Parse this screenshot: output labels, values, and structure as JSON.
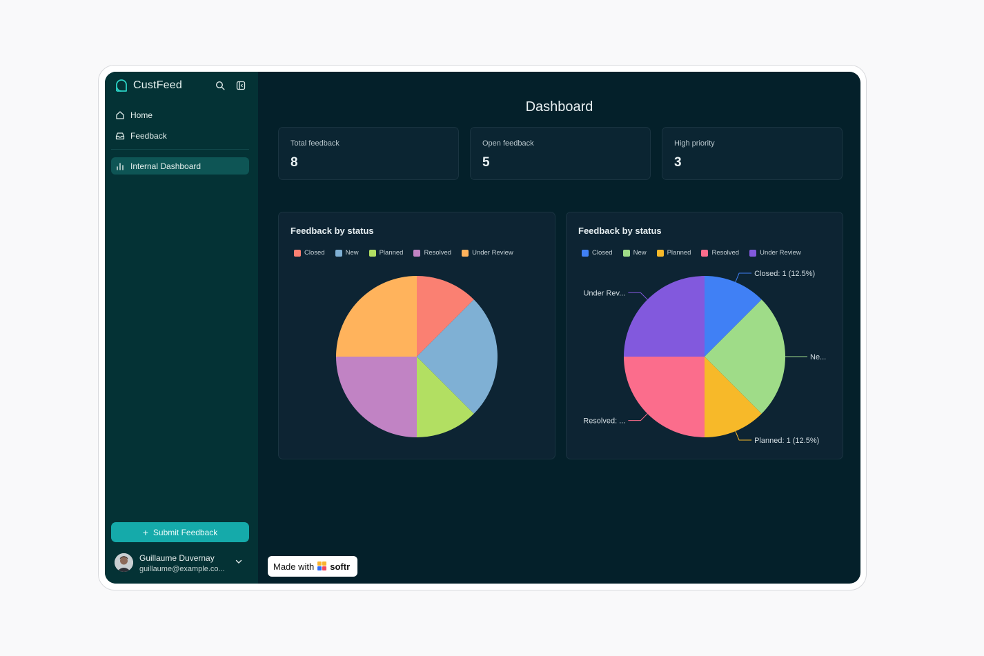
{
  "app": {
    "brand": "CustFeed",
    "page_title": "Dashboard"
  },
  "sidebar": {
    "items": [
      {
        "label": "Home",
        "icon": "home-icon"
      },
      {
        "label": "Feedback",
        "icon": "inbox-icon"
      },
      {
        "label": "Internal Dashboard",
        "icon": "bar-chart-icon",
        "active": true
      }
    ],
    "submit_label": "Submit Feedback",
    "user": {
      "name": "Guillaume Duvernay",
      "email": "guillaume@example.co..."
    }
  },
  "stats": [
    {
      "label": "Total feedback",
      "value": "8"
    },
    {
      "label": "Open feedback",
      "value": "5"
    },
    {
      "label": "High priority",
      "value": "3"
    }
  ],
  "badge": {
    "made_with": "Made with",
    "brand": "softr"
  },
  "colors": {
    "sidebar_bg": "#043235",
    "main_bg": "#04202a",
    "active_nav": "#0e5555",
    "accent": "#15aaaa"
  },
  "chart_data": [
    {
      "type": "pie",
      "title": "Feedback by status",
      "legend": "top-left",
      "series": [
        {
          "name": "Closed",
          "value": 1,
          "color": "#fa8072"
        },
        {
          "name": "New",
          "value": 2,
          "color": "#7fb0d4"
        },
        {
          "name": "Planned",
          "value": 1,
          "color": "#b2df62"
        },
        {
          "name": "Resolved",
          "value": 2,
          "color": "#c183c4"
        },
        {
          "name": "Under Review",
          "value": 2,
          "color": "#ffb35c"
        }
      ]
    },
    {
      "type": "pie",
      "title": "Feedback by status",
      "legend": "top-left",
      "series": [
        {
          "name": "Closed",
          "value": 1,
          "color": "#4080f5",
          "label": "Closed: 1 (12.5%)"
        },
        {
          "name": "New",
          "value": 2,
          "color": "#9fdc88",
          "label": "Ne..."
        },
        {
          "name": "Planned",
          "value": 1,
          "color": "#f7b929",
          "label": "Planned: 1 (12.5%)"
        },
        {
          "name": "Resolved",
          "value": 2,
          "color": "#fb6d8c",
          "label": "Resolved: ..."
        },
        {
          "name": "Under Review",
          "value": 2,
          "color": "#8259dd",
          "label": "Under Rev..."
        }
      ]
    }
  ]
}
